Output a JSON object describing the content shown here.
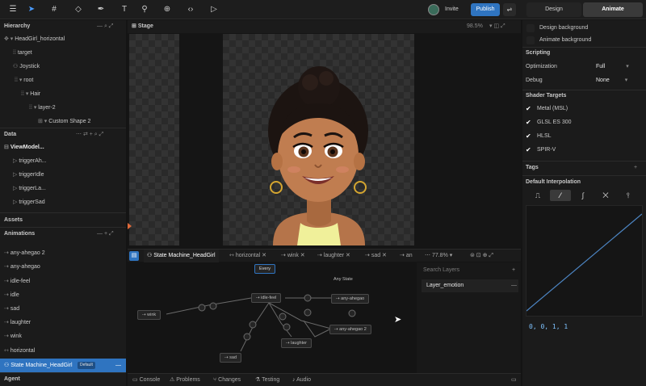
{
  "toolbar": {
    "invite_label": "Invite",
    "publish_label": "Publish",
    "design_tab": "Design",
    "animate_tab": "Animate"
  },
  "hierarchy": {
    "title": "Hierarchy",
    "items": [
      "HeadGirl_horizontal",
      "target",
      "Joystick",
      "root",
      "Hair",
      "layer-2",
      "Custom Shape 2"
    ]
  },
  "data_panel": {
    "title": "Data",
    "viewmodel": "ViewModel...",
    "items": [
      "triggerAh...",
      "triggerIdle",
      "triggerLa...",
      "triggerSad"
    ]
  },
  "assets": {
    "title": "Assets"
  },
  "animations": {
    "title": "Animations",
    "items": [
      "any-ahegao 2",
      "any-ahegao",
      "idle-feel",
      "idle",
      "sad",
      "laughter",
      "wink",
      "horizontal"
    ],
    "state_machine": "State Machine_HeadGirl",
    "default_badge": "Default"
  },
  "agent": {
    "title": "Agent"
  },
  "stage": {
    "title": "Stage",
    "zoom": "98.5%"
  },
  "timeline": {
    "tabs": [
      "State Machine_HeadGirl",
      "horizontal",
      "wink",
      "laughter",
      "sad",
      "an"
    ],
    "zoom": "77.8%",
    "search_placeholder": "Search Layers",
    "layer": "Layer_emotion"
  },
  "state_nodes": {
    "every": "Every",
    "any_state": "Any State",
    "idle_feel": "idle-feel",
    "any_ahegao": "any-ahegao",
    "any_ahegao2": "any-ahegao 2",
    "wink": "wink",
    "laughter": "laughter",
    "sad": "sad"
  },
  "bottom_tabs": [
    "Console",
    "Problems",
    "Changes",
    "Testing",
    "Audio"
  ],
  "right_panel": {
    "design_background": "Design background",
    "animate_background": "Animate background",
    "scripting_title": "Scripting",
    "optimization_label": "Optimization",
    "optimization_value": "Full",
    "debug_label": "Debug",
    "debug_value": "None",
    "shader_targets_title": "Shader Targets",
    "shader_targets": [
      "Metal (MSL)",
      "GLSL ES 300",
      "HLSL",
      "SPIR-V"
    ],
    "tags_title": "Tags",
    "default_interpolation_title": "Default Interpolation",
    "curve_values": "0, 0, 1, 1"
  },
  "colors": {
    "accent": "#2f74c0",
    "curve_value": "#7fc3ff",
    "selection": "#2f74c0"
  }
}
